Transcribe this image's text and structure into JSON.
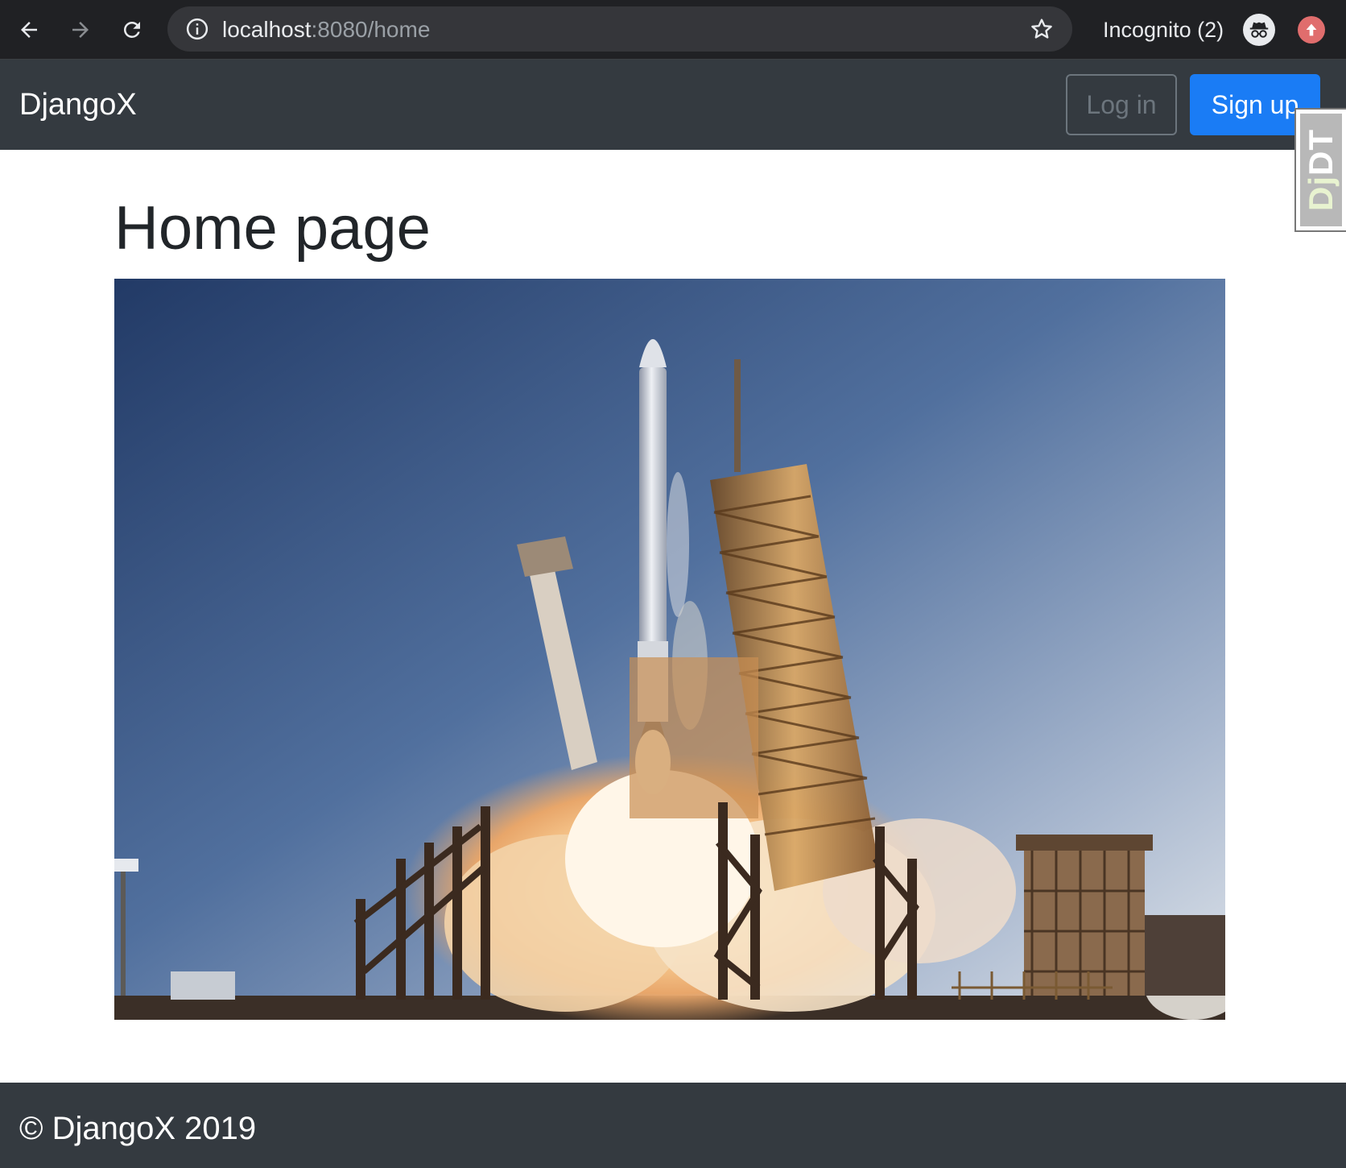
{
  "browser": {
    "url_host": "localhost",
    "url_rest": ":8080/home",
    "incognito_label": "Incognito (2)"
  },
  "navbar": {
    "brand": "DjangoX",
    "login_label": "Log in",
    "signup_label": "Sign up"
  },
  "debug_toolbar": {
    "handle_prefix": "Dj",
    "handle_suffix": "DT"
  },
  "main": {
    "title": "Home page"
  },
  "footer": {
    "text": "© DjangoX 2019"
  },
  "colors": {
    "navbar_bg": "#343a40",
    "primary": "#1a7cf5",
    "secondary": "#6c757d",
    "chrome_bg": "#202124"
  },
  "icons": {
    "back": "arrow-left-icon",
    "forward": "arrow-right-icon",
    "reload": "reload-icon",
    "site_info": "info-icon",
    "bookmark": "star-icon",
    "incognito": "incognito-icon",
    "update": "arrow-up-icon"
  }
}
